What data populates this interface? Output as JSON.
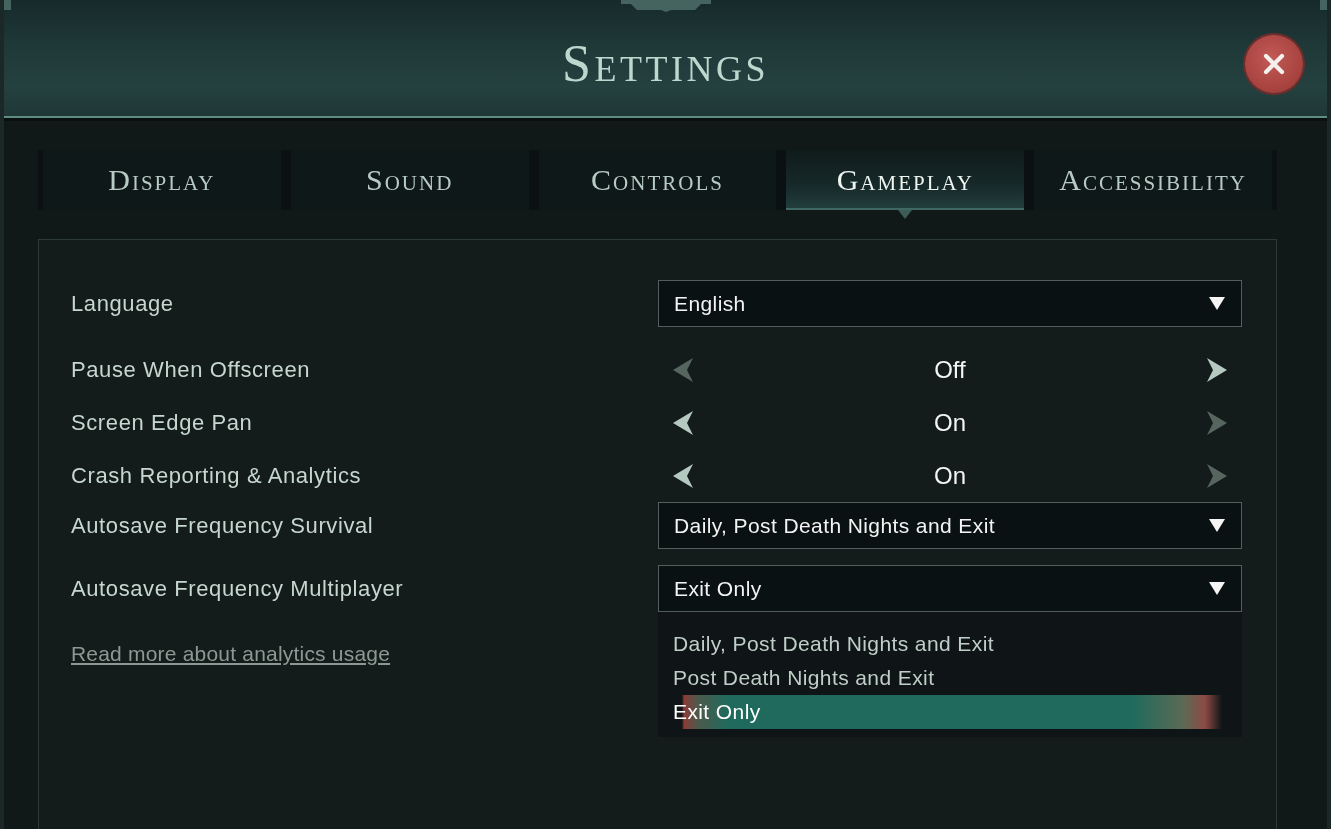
{
  "window": {
    "title": "Settings"
  },
  "tabs": [
    {
      "label": "Display",
      "selected": false
    },
    {
      "label": "Sound",
      "selected": false
    },
    {
      "label": "Controls",
      "selected": false
    },
    {
      "label": "Gameplay",
      "selected": true
    },
    {
      "label": "Accessibility",
      "selected": false
    }
  ],
  "rows": [
    {
      "kind": "dropdown",
      "label": "Language",
      "value": "English"
    },
    {
      "kind": "toggle",
      "label": "Pause When Offscreen",
      "value": "Off",
      "prev_disabled": true,
      "next_disabled": false
    },
    {
      "kind": "toggle",
      "label": "Screen Edge Pan",
      "value": "On",
      "prev_disabled": false,
      "next_disabled": true
    },
    {
      "kind": "toggle",
      "label": "Crash Reporting & Analytics",
      "value": "On",
      "prev_disabled": false,
      "next_disabled": true
    },
    {
      "kind": "dropdown",
      "label": "Autosave Frequency Survival",
      "value": "Daily, Post Death Nights and Exit"
    },
    {
      "kind": "dropdown",
      "label": "Autosave Frequency Multiplayer",
      "value": "Exit Only",
      "expanded": true,
      "options": [
        {
          "label": "Daily, Post Death Nights and Exit",
          "selected": false
        },
        {
          "label": "Post Death Nights and Exit",
          "selected": false
        },
        {
          "label": "Exit Only",
          "selected": true
        }
      ]
    }
  ],
  "link": {
    "text": "Read more about analytics usage"
  }
}
